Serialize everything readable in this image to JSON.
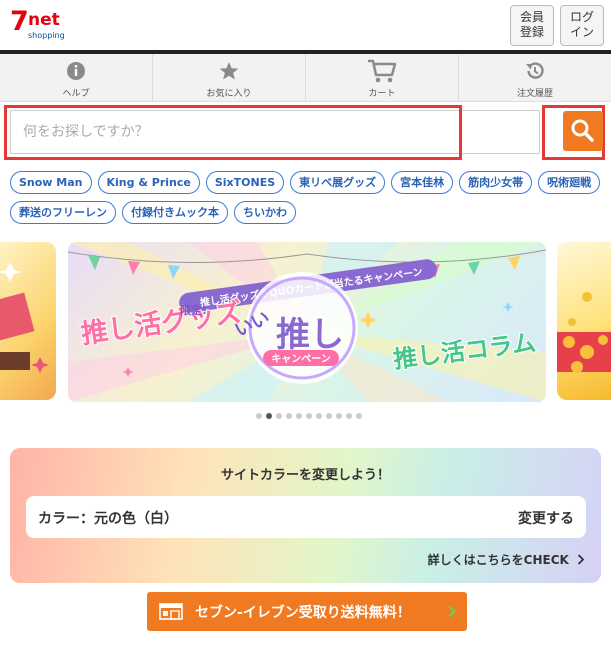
{
  "header": {
    "logo_text_top": "7net",
    "logo_text_bottom": "shopping",
    "login_label": "会員\n登録",
    "login2_label": "ログ\nイン"
  },
  "nav": {
    "items": [
      {
        "label": "ヘルプ",
        "icon": "info-icon"
      },
      {
        "label": "お気に入り",
        "icon": "star-icon"
      },
      {
        "label": "カート",
        "icon": "cart-icon"
      },
      {
        "label": "注文履歴",
        "icon": "history-icon"
      }
    ]
  },
  "search": {
    "placeholder": "何をお探しですか？",
    "value": ""
  },
  "tags": [
    "Snow Man",
    "King & Prince",
    "SixTONES",
    "東リベ展グッズ",
    "宮本佳林",
    "筋肉少女帯",
    "呪術廻戦",
    "葬送のフリーレン",
    "付録付きムック本",
    "ちいかわ"
  ],
  "carousel": {
    "active_index": 1,
    "total": 11,
    "banner_texts": {
      "ribbon": "推し活グッズやQUOカードが当たるキャンペーン",
      "left": "推し活グッズ",
      "center": "推し",
      "center_badge": "キャンペーン",
      "right": "推し活コラム",
      "limited": "限定!",
      "iin": "いい"
    }
  },
  "color_panel": {
    "title": "サイトカラーを変更しよう！",
    "current_label": "カラー：元の色（白）",
    "change_label": "変更する",
    "more_label": "詳しくはこちらをCHECK"
  },
  "promo": {
    "label": "セブン-イレブン受取り送料無料！"
  },
  "colors": {
    "accent": "#f07a22",
    "tag_border": "#3a7dd0",
    "highlight": "#e53935",
    "brand_red": "#e60012"
  }
}
